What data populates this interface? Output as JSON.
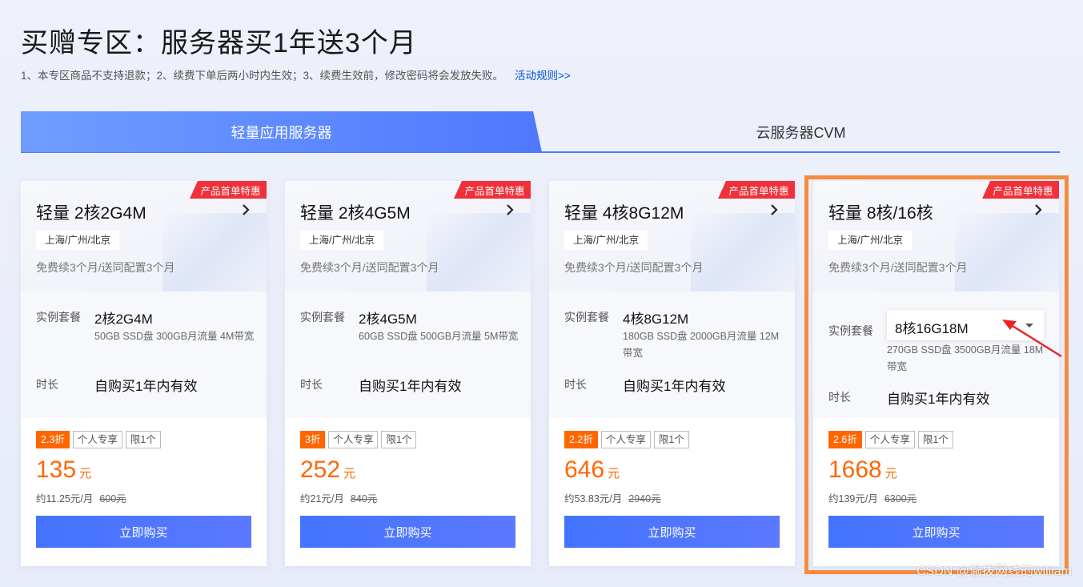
{
  "header": {
    "title": "买赠专区：服务器买1年送3个月",
    "notice": "1、本专区商品不支持退款；2、续费下单后两小时内生效；3、续费生效前，修改密码将会发放失败。",
    "rules_link": "活动规则>>"
  },
  "tabs": [
    {
      "label": "轻量应用服务器",
      "active": true
    },
    {
      "label": "云服务器CVM",
      "active": false
    }
  ],
  "colors": {
    "accent": "#4f78ff",
    "price": "#ff6600",
    "ribbon": "#f0313a",
    "highlight": "#f68b3f"
  },
  "cards": [
    {
      "ribbon": "产品首单特惠",
      "title": "轻量 2核2G4M",
      "region": "上海/广州/北京",
      "gift": "免费续3个月/送同配置3个月",
      "spec_label": "实例套餐",
      "spec_value": "2核2G4M",
      "spec_desc": "50GB SSD盘 300GB月流量 4M带宽",
      "duration_label": "时长",
      "duration_value": "自购买1年内有效",
      "discount": "2.3折",
      "tag1": "个人专享",
      "tag2": "限1个",
      "price": "135",
      "price_unit": "元",
      "monthly": "约11.25元/月",
      "original": "600元",
      "buy": "立即购买"
    },
    {
      "ribbon": "产品首单特惠",
      "title": "轻量 2核4G5M",
      "region": "上海/广州/北京",
      "gift": "免费续3个月/送同配置3个月",
      "spec_label": "实例套餐",
      "spec_value": "2核4G5M",
      "spec_desc": "60GB SSD盘 500GB月流量 5M带宽",
      "duration_label": "时长",
      "duration_value": "自购买1年内有效",
      "discount": "3折",
      "tag1": "个人专享",
      "tag2": "限1个",
      "price": "252",
      "price_unit": "元",
      "monthly": "约21元/月",
      "original": "840元",
      "buy": "立即购买"
    },
    {
      "ribbon": "产品首单特惠",
      "title": "轻量 4核8G12M",
      "region": "上海/广州/北京",
      "gift": "免费续3个月/送同配置3个月",
      "spec_label": "实例套餐",
      "spec_value": "4核8G12M",
      "spec_desc": "180GB SSD盘 2000GB月流量 12M带宽",
      "duration_label": "时长",
      "duration_value": "自购买1年内有效",
      "discount": "2.2折",
      "tag1": "个人专享",
      "tag2": "限1个",
      "price": "646",
      "price_unit": "元",
      "monthly": "约53.83元/月",
      "original": "2940元",
      "buy": "立即购买"
    },
    {
      "ribbon": "产品首单特惠",
      "title": "轻量 8核/16核",
      "region": "上海/广州/北京",
      "gift": "免费续3个月/送同配置3个月",
      "spec_label": "实例套餐",
      "spec_value": "8核16G18M",
      "spec_desc": "270GB SSD盘 3500GB月流量 18M带宽",
      "duration_label": "时长",
      "duration_value": "自购买1年内有效",
      "discount": "2.6折",
      "tag1": "个人专享",
      "tag2": "限1个",
      "price": "1668",
      "price_unit": "元",
      "monthly": "约139元/月",
      "original": "6300元",
      "buy": "立即购买"
    }
  ],
  "icons": {
    "chevron": "chevron-right-icon",
    "caret": "caret-down-icon",
    "arrow": "red-arrow-annotation-icon"
  },
  "watermark": "CSDN @偷拨网线的william"
}
